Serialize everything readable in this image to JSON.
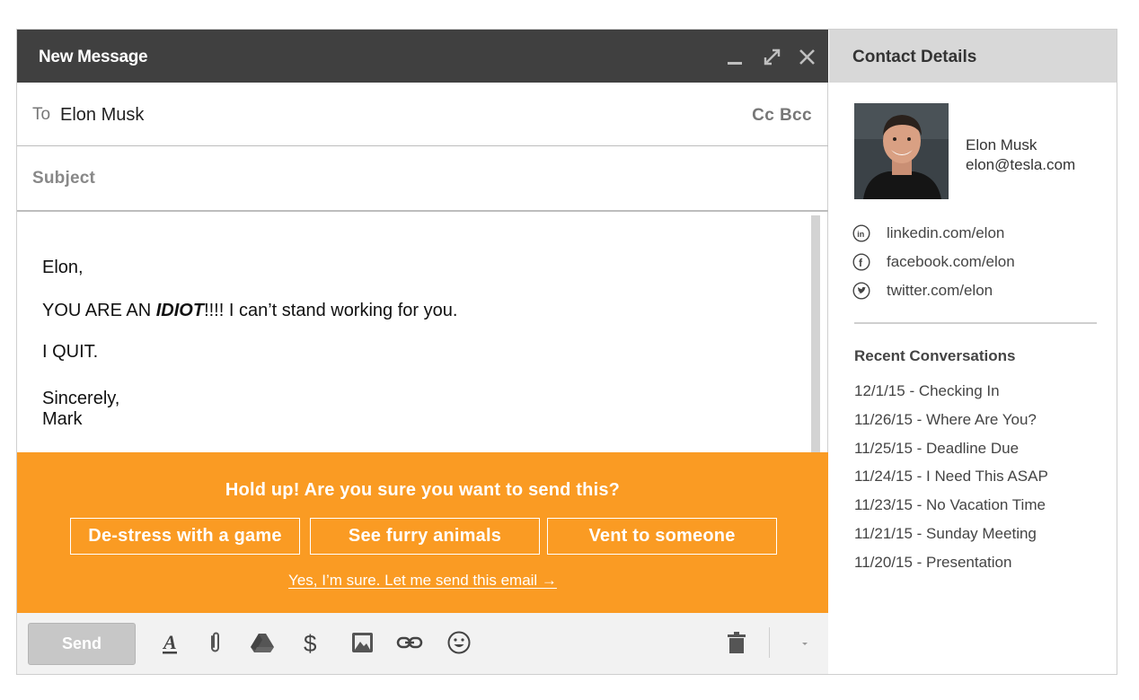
{
  "compose": {
    "window_title": "New Message",
    "to_label": "To",
    "to_value": "Elon Musk",
    "cc_bcc": "Cc Bcc",
    "subject_placeholder": "Subject",
    "body": {
      "greeting": "Elon,",
      "line1_prefix": "YOU ARE AN ",
      "line1_emph": "IDIOT",
      "line1_suffix": "!!!! I can’t stand working for you.",
      "line2": "I QUIT.",
      "signoff": "Sincerely,",
      "signature": "Mark"
    }
  },
  "warning": {
    "question": "Hold up! Are you sure you want to send this?",
    "options": [
      "De-stress with a game",
      "See furry animals",
      "Vent to someone"
    ],
    "confirm_link": "Yes, I’m sure. Let me send this email →",
    "background_color": "#fa9b23"
  },
  "toolbar": {
    "send_label": "Send",
    "icons": [
      "formatting-icon",
      "attachment-icon",
      "drive-icon",
      "money-icon",
      "photo-icon",
      "link-icon",
      "emoji-icon",
      "trash-icon",
      "more-options-icon"
    ]
  },
  "contact": {
    "header": "Contact Details",
    "name": "Elon Musk",
    "email": "elon@tesla.com",
    "linkedin": "linkedin.com/elon",
    "facebook": "facebook.com/elon",
    "twitter": "twitter.com/elon",
    "recent_title": "Recent Conversations",
    "recent": [
      "12/1/15 - Checking In",
      "11/26/15 - Where Are You?",
      "11/25/15 - Deadline Due",
      "11/24/15 - I Need This ASAP",
      "11/23/15 - No Vacation Time",
      "11/21/15 - Sunday Meeting",
      "11/20/15 - Presentation"
    ]
  }
}
